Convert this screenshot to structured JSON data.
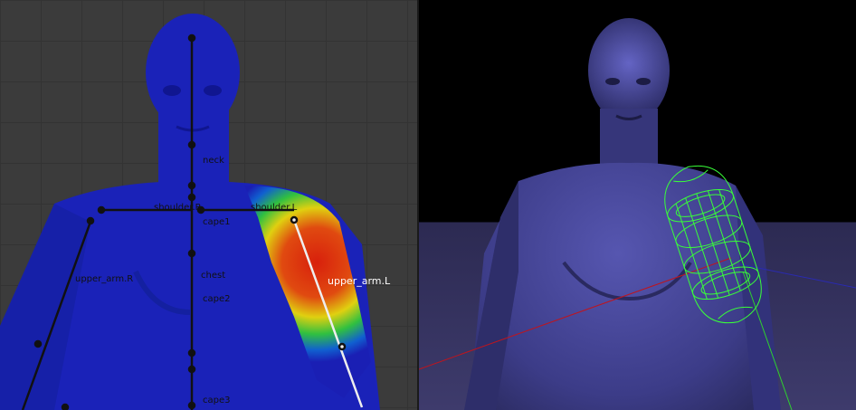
{
  "left_viewport": {
    "mode": "weight-paint",
    "bones": {
      "shoulder_r": "shoulder.R",
      "shoulder_l": "shoulder.L",
      "neck": "neck",
      "cape1": "cape1",
      "chest": "chest",
      "cape2": "cape2",
      "cape3": "cape3",
      "upper_arm_r": "upper_arm.R",
      "upper_arm_l": "upper_arm.L"
    }
  },
  "right_viewport": {
    "mode": "solid-render",
    "colors": {
      "x_axis": "#c0141c",
      "y_axis": "#2ed12e",
      "z_axis": "#2a2ab0",
      "collider": "#39ff39"
    }
  },
  "colors": {
    "grid_bg": "#3b3b3b",
    "weight_zero": "#1a1fb4",
    "weight_high": "#e02010",
    "skin_render": "#4a4a9a"
  }
}
